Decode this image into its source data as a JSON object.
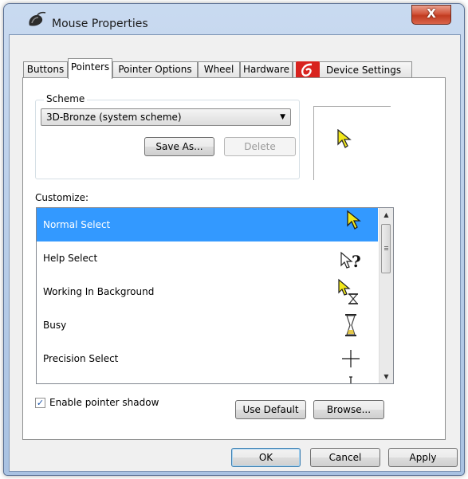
{
  "window": {
    "title": "Mouse Properties",
    "close_glyph": "X"
  },
  "tabs": [
    "Buttons",
    "Pointers",
    "Pointer Options",
    "Wheel",
    "Hardware",
    "Device Settings"
  ],
  "active_tab": "Pointers",
  "scheme": {
    "legend": "Scheme",
    "selected": "3D-Bronze (system scheme)",
    "save_as": "Save As...",
    "delete": "Delete"
  },
  "customize": {
    "label": "Customize:",
    "items": [
      {
        "label": "Normal Select",
        "icon": "bronze-arrow-icon",
        "selected": true
      },
      {
        "label": "Help Select",
        "icon": "help-select-icon",
        "glyph": "?"
      },
      {
        "label": "Working In Background",
        "icon": "working-background-icon"
      },
      {
        "label": "Busy",
        "icon": "hourglass-icon"
      },
      {
        "label": "Precision Select",
        "icon": "crosshair-icon"
      }
    ]
  },
  "shadow": {
    "label": "Enable pointer shadow",
    "checked": true
  },
  "buttons": {
    "use_default": "Use Default",
    "browse": "Browse...",
    "ok": "OK",
    "cancel": "Cancel",
    "apply": "Apply"
  },
  "colors": {
    "selection": "#3399ff",
    "pointer_bronze": "#f2e81a"
  }
}
